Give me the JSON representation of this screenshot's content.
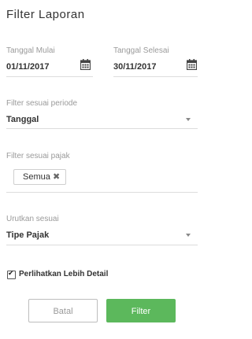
{
  "title": "Filter Laporan",
  "start_date": {
    "label": "Tanggal Mulai",
    "value": "01/11/2017",
    "icon": "calendar-icon"
  },
  "end_date": {
    "label": "Tanggal Selesai",
    "value": "30/11/2017",
    "icon": "calendar-icon"
  },
  "period_filter": {
    "label": "Filter sesuai periode",
    "value": "Tanggal",
    "icon": "caret-down-icon"
  },
  "tax_filter": {
    "label": "Filter sesuai pajak",
    "chips": [
      {
        "label": "Semua",
        "remove_glyph": "✖"
      }
    ]
  },
  "sort_by": {
    "label": "Urutkan sesuai",
    "value": "Tipe Pajak",
    "icon": "caret-down-icon"
  },
  "show_detail": {
    "label": "Perlihatkan Lebih Detail",
    "checked": true,
    "check_glyph": "✔"
  },
  "buttons": {
    "cancel": "Batal",
    "filter": "Filter"
  },
  "colors": {
    "accent": "#5cb85c",
    "muted_text": "#9a9a9a",
    "divider": "#dcdcdc"
  }
}
